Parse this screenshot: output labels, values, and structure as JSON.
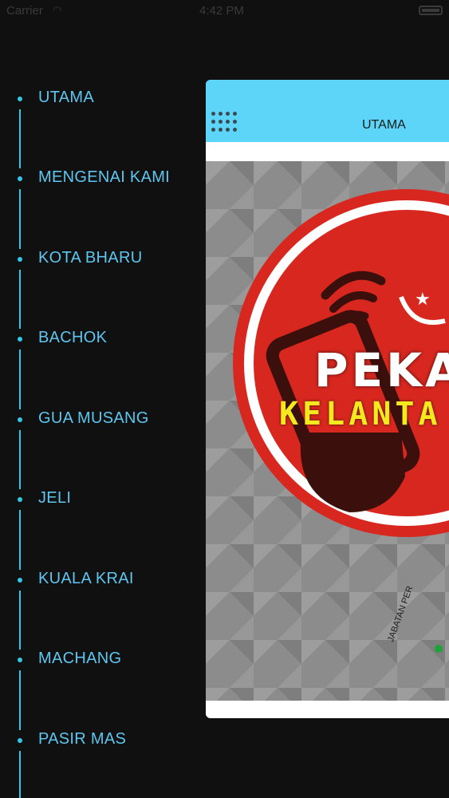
{
  "status_bar": {
    "carrier": "Carrier",
    "time": "4:42 PM"
  },
  "menu": {
    "items": [
      {
        "label": "UTAMA"
      },
      {
        "label": "MENGENAI KAMI"
      },
      {
        "label": "KOTA BHARU"
      },
      {
        "label": "BACHOK"
      },
      {
        "label": "GUA MUSANG"
      },
      {
        "label": "JELI"
      },
      {
        "label": "KUALA KRAI"
      },
      {
        "label": "MACHANG"
      },
      {
        "label": "PASIR MAS"
      }
    ]
  },
  "header": {
    "title": "UTAMA",
    "menu_icon": "grid-menu-icon"
  },
  "banner": {
    "logo_text_line1": "PEKA",
    "logo_text_line2": "KELANTA",
    "arc_text": "JABATAN PER",
    "colors": {
      "red": "#d7271e",
      "yellow": "#f4e81f",
      "dark": "#3a0f0c"
    }
  },
  "colors": {
    "accent": "#35c7e6",
    "menu_text": "#5ec6ef",
    "navbar": "#5dd5f8",
    "background": "#101010"
  }
}
